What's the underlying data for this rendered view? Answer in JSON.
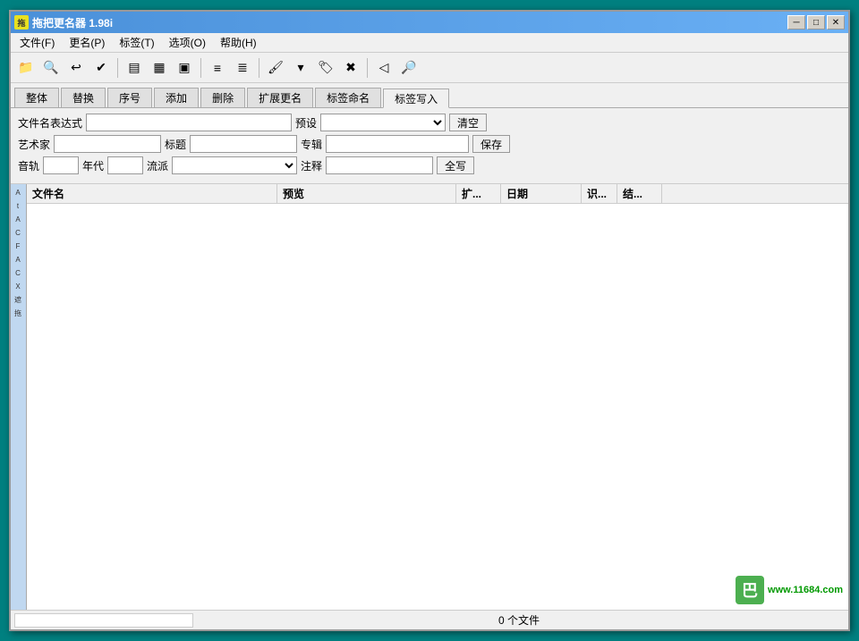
{
  "window": {
    "title": "拖把更名器 1.98i",
    "icon_text": "拖"
  },
  "title_controls": {
    "minimize": "─",
    "maximize": "□",
    "close": "✕"
  },
  "menu": {
    "items": [
      {
        "id": "file",
        "label": "文件(F)"
      },
      {
        "id": "rename",
        "label": "更名(P)"
      },
      {
        "id": "tag",
        "label": "标签(T)"
      },
      {
        "id": "option",
        "label": "选项(O)"
      },
      {
        "id": "help",
        "label": "帮助(H)"
      }
    ]
  },
  "tabs": {
    "items": [
      {
        "id": "overall",
        "label": "整体"
      },
      {
        "id": "replace",
        "label": "替换"
      },
      {
        "id": "sequence",
        "label": "序号"
      },
      {
        "id": "add",
        "label": "添加"
      },
      {
        "id": "delete",
        "label": "删除"
      },
      {
        "id": "extend",
        "label": "扩展更名"
      },
      {
        "id": "tagname",
        "label": "标签命名"
      },
      {
        "id": "tagwrite",
        "label": "标签写入",
        "active": true
      }
    ]
  },
  "form": {
    "filename_expr_label": "文件名表达式",
    "filename_expr_placeholder": "",
    "preset_label": "预设",
    "preset_value": "",
    "clear_label": "清空",
    "artist_label": "艺术家",
    "artist_value": "",
    "title_label": "标题",
    "title_value": "",
    "album_label": "专辑",
    "album_value": "",
    "save_label": "保存",
    "track_label": "音轨",
    "track_value": "",
    "year_label": "年代",
    "year_value": "",
    "genre_label": "流派",
    "genre_value": "",
    "comment_label": "注释",
    "comment_value": "",
    "fullwrite_label": "全写"
  },
  "file_list": {
    "columns": [
      {
        "id": "filename",
        "label": "文件名"
      },
      {
        "id": "preview",
        "label": "预览"
      },
      {
        "id": "ext",
        "label": "扩..."
      },
      {
        "id": "date",
        "label": "日期"
      },
      {
        "id": "id",
        "label": "识..."
      },
      {
        "id": "result",
        "label": "结..."
      }
    ],
    "rows": []
  },
  "status": {
    "file_count": "0 个文件"
  },
  "watermark": {
    "logo": "巴",
    "text": "www.11684.com"
  },
  "sidebar_icons": [
    "A",
    "t",
    "A",
    "C",
    "F",
    "A",
    "C",
    "X",
    "A",
    "遮",
    "拖"
  ]
}
